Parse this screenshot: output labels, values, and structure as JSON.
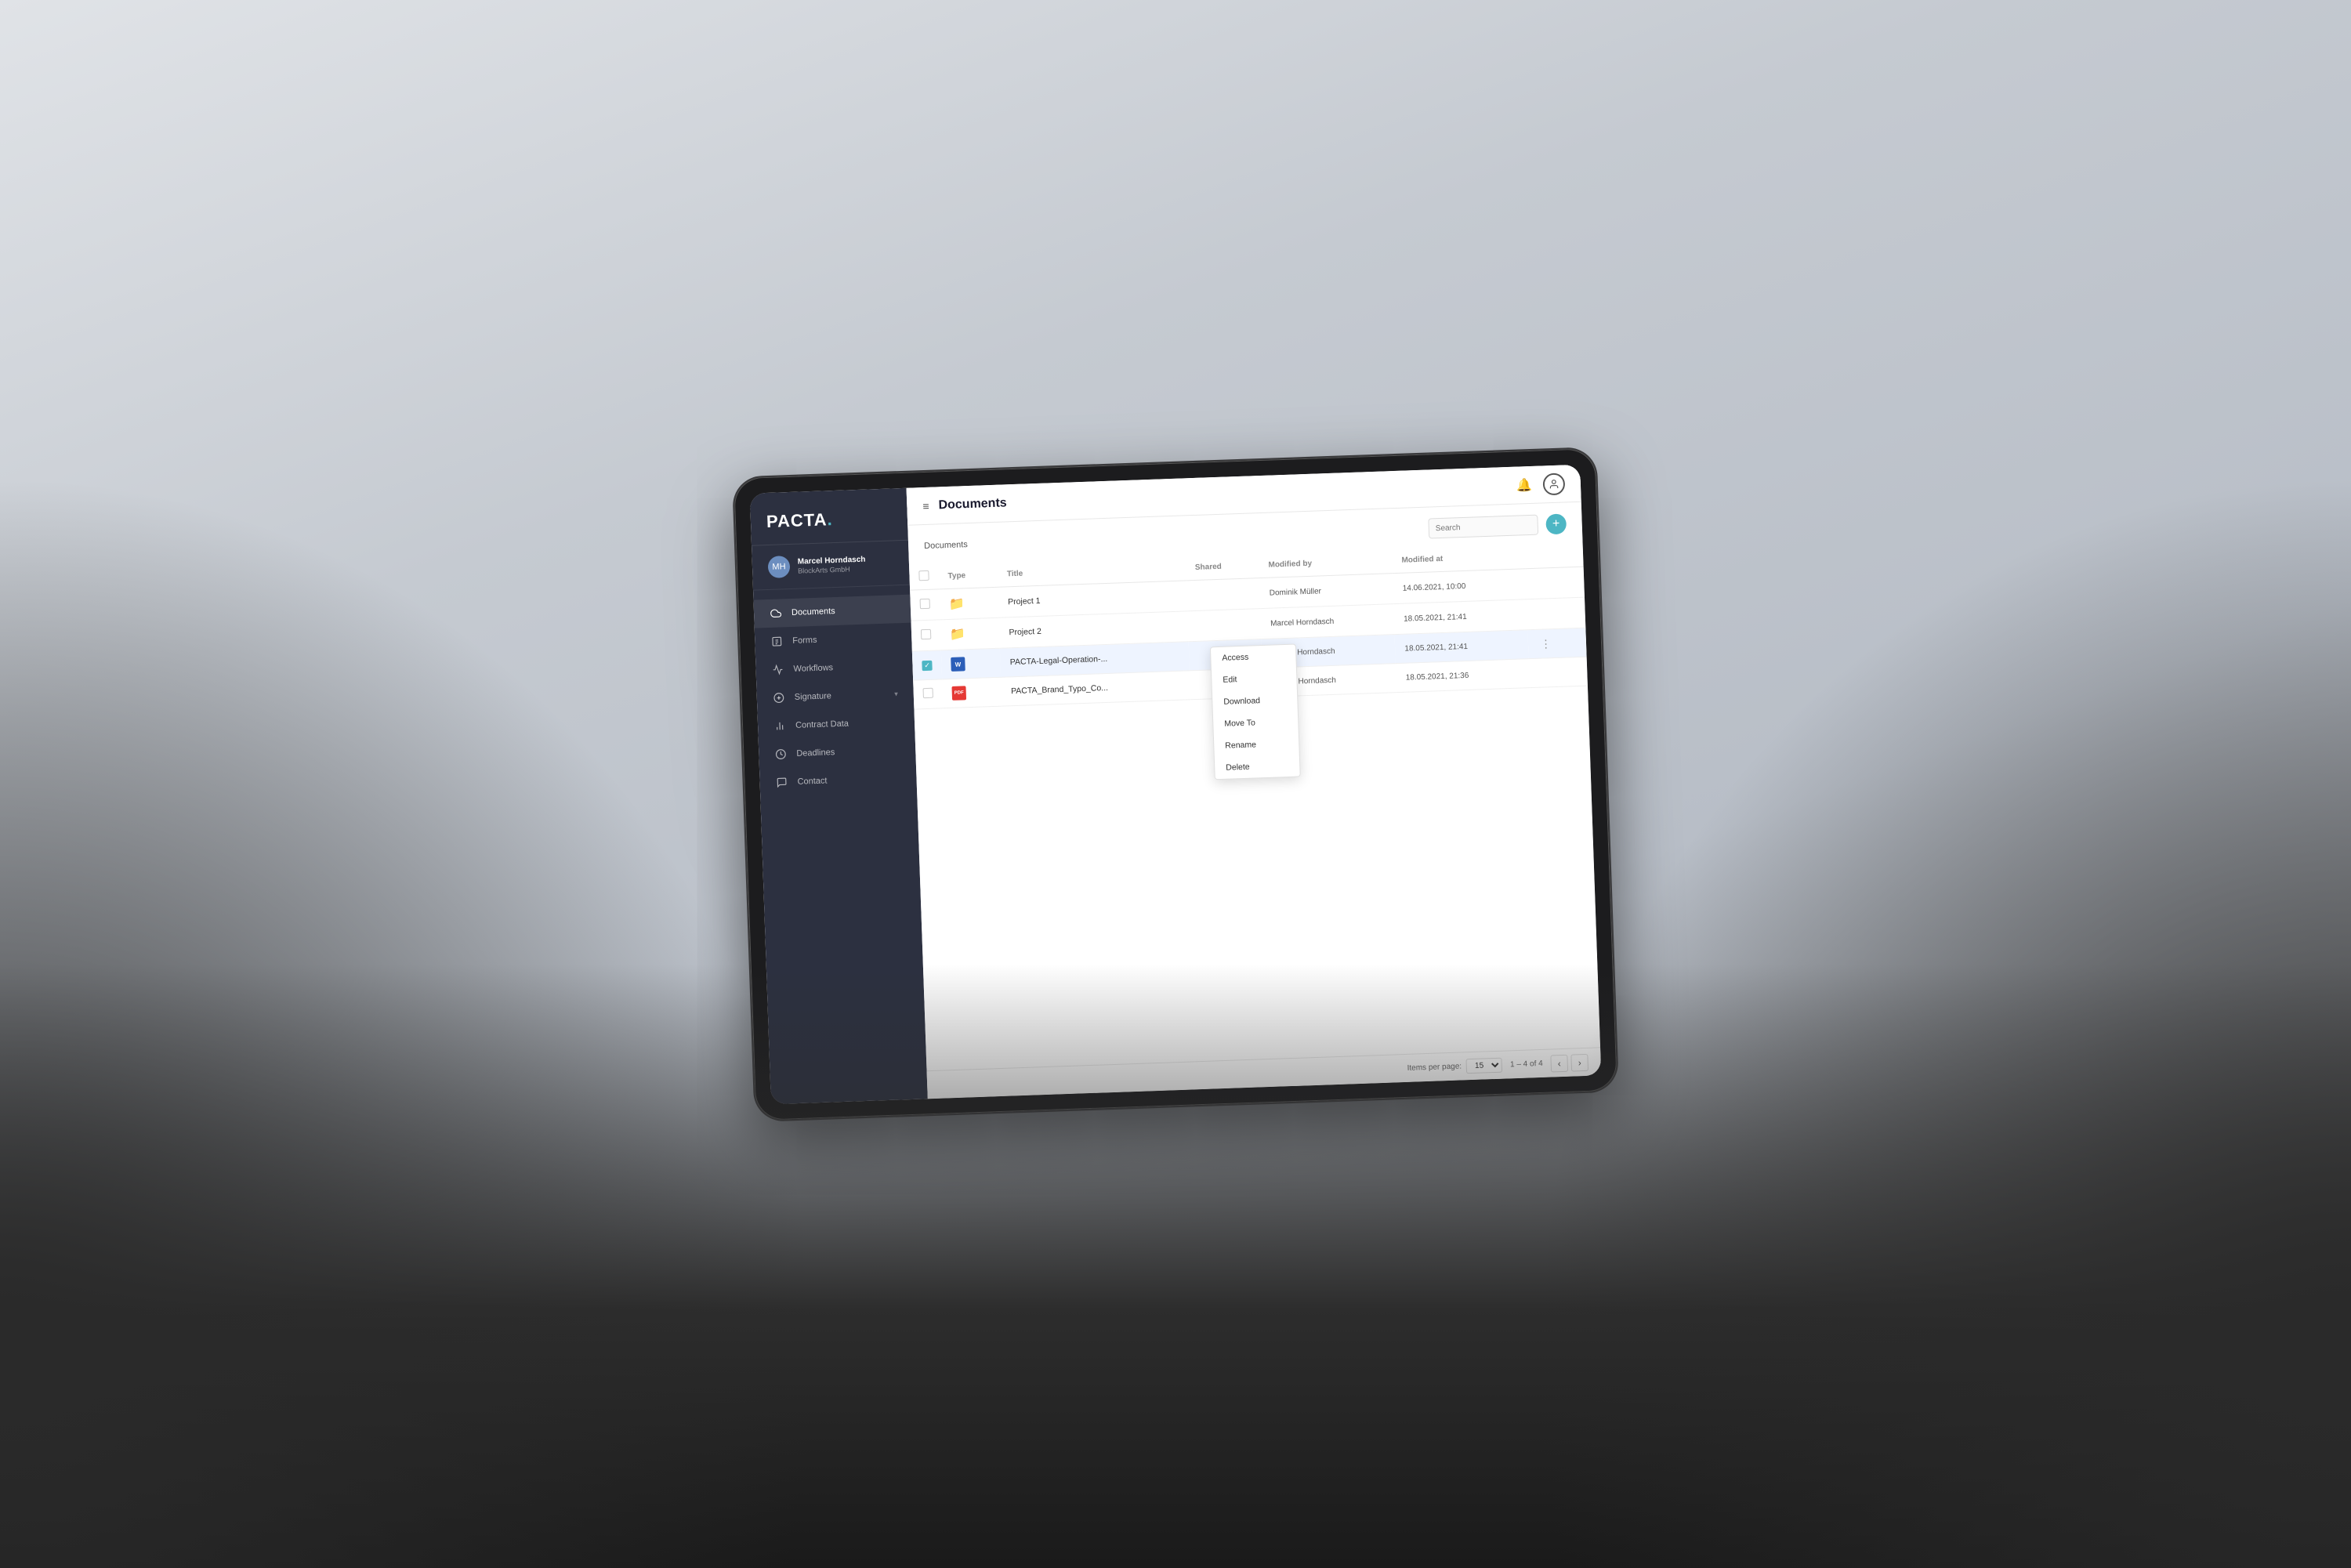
{
  "scene": {
    "tablet": {
      "sidebar": {
        "logo": "PACTA.",
        "user": {
          "name": "Marcel Horndasch",
          "company": "BlockArts GmbH"
        },
        "nav_items": [
          {
            "id": "documents",
            "label": "Documents",
            "icon": "cloud",
            "active": true
          },
          {
            "id": "forms",
            "label": "Forms",
            "icon": "forms"
          },
          {
            "id": "workflows",
            "label": "Workflows",
            "icon": "workflows"
          },
          {
            "id": "signature",
            "label": "Signature",
            "icon": "signature",
            "has_arrow": true
          },
          {
            "id": "contract-data",
            "label": "Contract Data",
            "icon": "bar-chart"
          },
          {
            "id": "deadlines",
            "label": "Deadlines",
            "icon": "clock"
          },
          {
            "id": "contact",
            "label": "Contact",
            "icon": "contact"
          }
        ]
      },
      "topbar": {
        "title": "Documents",
        "menu_icon": "≡"
      },
      "content": {
        "breadcrumb": "Documents",
        "search_placeholder": "Search",
        "add_button": "+",
        "table": {
          "columns": [
            "",
            "Type",
            "Title",
            "Shared",
            "Modified by",
            "Modified at"
          ],
          "rows": [
            {
              "id": 1,
              "type": "folder",
              "type_icon": "📁",
              "name": "Project 1",
              "shared": "",
              "modified_by": "Dominik Müller",
              "modified_at": "14.06.2021, 10:00",
              "selected": false
            },
            {
              "id": 2,
              "type": "folder",
              "type_icon": "📁",
              "name": "Project 2",
              "shared": "",
              "modified_by": "Marcel Horndasch",
              "modified_at": "18.05.2021, 21:41",
              "selected": false
            },
            {
              "id": 3,
              "type": "word",
              "type_icon": "W",
              "name": "PACTA-Legal-Operation-...",
              "shared": "",
              "modified_by": "Marcel Horndasch",
              "modified_at": "18.05.2021, 21:41",
              "selected": true
            },
            {
              "id": 4,
              "type": "pdf",
              "type_icon": "PDF",
              "name": "PACTA_Brand_Typo_Co...",
              "shared": "",
              "modified_by": "Marcel Horndasch",
              "modified_at": "18.05.2021, 21:36",
              "selected": false
            }
          ]
        },
        "context_menu": {
          "items": [
            {
              "id": "access",
              "label": "Access"
            },
            {
              "id": "edit",
              "label": "Edit"
            },
            {
              "id": "download",
              "label": "Download"
            },
            {
              "id": "move-to",
              "label": "Move To"
            },
            {
              "id": "rename",
              "label": "Rename"
            },
            {
              "id": "delete",
              "label": "Delete"
            }
          ]
        },
        "pagination": {
          "items_per_page_label": "Items per page:",
          "items_per_page_value": "15",
          "page_info": "1 – 4 of 4"
        }
      }
    }
  }
}
